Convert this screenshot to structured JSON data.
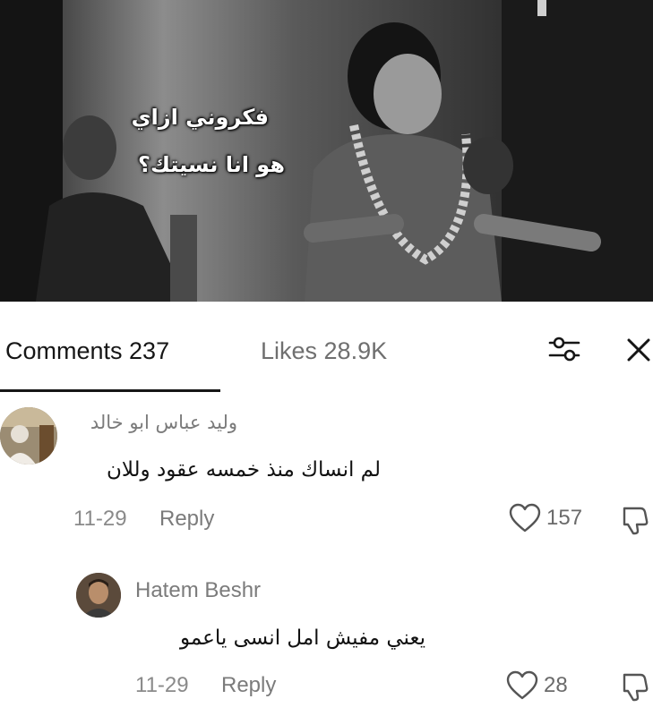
{
  "video": {
    "caption_line1": "فكروني ازاي",
    "caption_line2": "هو انا نسيتك؟"
  },
  "tabs": {
    "comments_label": "Comments 237",
    "likes_label": "Likes 28.9K"
  },
  "icons": {
    "filter": "sliders-icon",
    "close": "close-icon",
    "like": "heart-outline-icon",
    "dislike": "thumbs-down-outline-icon"
  },
  "comments": [
    {
      "author": "وليد عباس ابو خالد",
      "text": "لم انساك منذ خمسه عقود وللان",
      "date": "11-29",
      "reply_label": "Reply",
      "likes": "157"
    },
    {
      "author": "Hatem Beshr",
      "text": "يعني مفيش امل انسى ياعمو",
      "date": "11-29",
      "reply_label": "Reply",
      "likes": "28"
    }
  ],
  "colors": {
    "primary_text": "#161616",
    "secondary_text": "#7b7b7b",
    "background": "#ffffff"
  }
}
